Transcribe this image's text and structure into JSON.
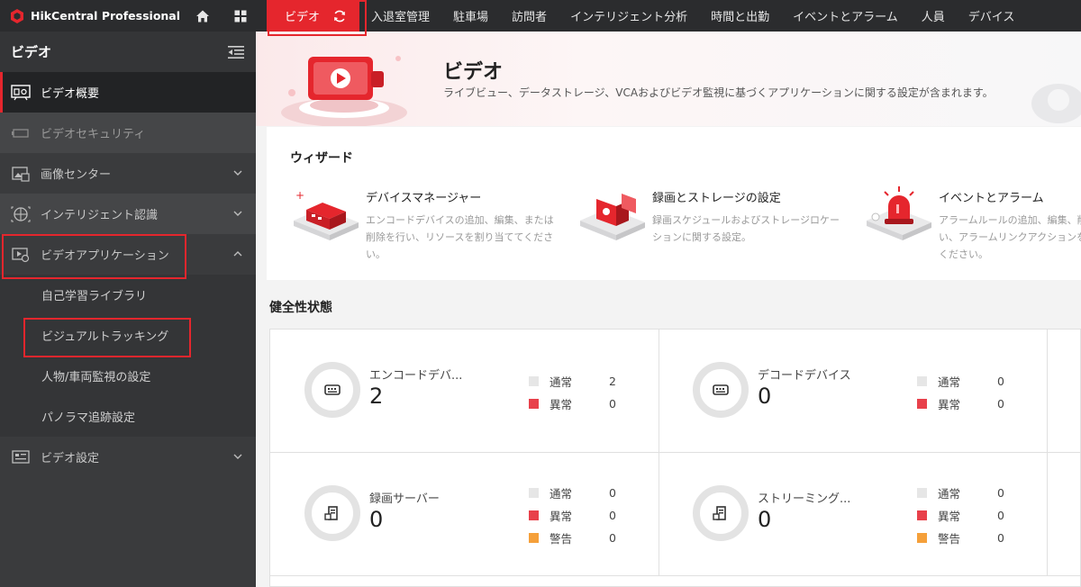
{
  "app": {
    "name": "HikCentral Professional"
  },
  "topnav": {
    "items": [
      {
        "label": "ビデオ",
        "active": true
      },
      {
        "label": "入退室管理"
      },
      {
        "label": "駐車場"
      },
      {
        "label": "訪問者"
      },
      {
        "label": "インテリジェント分析"
      },
      {
        "label": "時間と出勤"
      },
      {
        "label": "イベントとアラーム"
      },
      {
        "label": "人員"
      },
      {
        "label": "デバイス"
      }
    ]
  },
  "sidebar": {
    "title": "ビデオ",
    "items": [
      {
        "label": "ビデオ概要",
        "icon": "video-overview-icon",
        "active": true
      },
      {
        "label": "ビデオセキュリティ",
        "icon": "camera-icon"
      },
      {
        "label": "画像センター",
        "icon": "image-icon",
        "expandable": true
      },
      {
        "label": "インテリジェント認識",
        "icon": "recognition-icon",
        "expandable": true
      },
      {
        "label": "ビデオアプリケーション",
        "icon": "video-app-icon",
        "expanded": true
      },
      {
        "label": "ビデオ設定",
        "icon": "video-settings-icon",
        "expandable": true
      }
    ],
    "subitems": [
      {
        "label": "自己学習ライブラリ"
      },
      {
        "label": "ビジュアルトラッキング"
      },
      {
        "label": "人物/車両監視の設定"
      },
      {
        "label": "パノラマ追跡設定"
      }
    ]
  },
  "banner": {
    "title": "ビデオ",
    "subtitle": "ライブビュー、データストレージ、VCAおよびビデオ監視に基づくアプリケーションに関する設定が含まれます。"
  },
  "wizard": {
    "title": "ウィザード",
    "cards": [
      {
        "name": "デバイスマネージャー",
        "desc": "エンコードデバイスの追加、編集、または削除を行い、リソースを割り当ててください。"
      },
      {
        "name": "録画とストレージの設定",
        "desc": "録画スケジュールおよびストレージロケーションに関する設定。"
      },
      {
        "name": "イベントとアラーム",
        "desc": "アラームルールの追加、編集、削除を行い、アラームリンクアクションを設定してください。"
      }
    ]
  },
  "health": {
    "title": "健全性状態",
    "colors": {
      "normal": "#e6e6e6",
      "error": "#e8414b",
      "warning": "#f5a03a"
    },
    "cells": [
      {
        "name": "エンコードデバ...",
        "count": "2",
        "icon": "encoder-icon",
        "legend": [
          {
            "label": "通常",
            "value": "2",
            "kind": "normal"
          },
          {
            "label": "異常",
            "value": "0",
            "kind": "error"
          }
        ]
      },
      {
        "name": "デコードデバイス",
        "count": "0",
        "icon": "decoder-icon",
        "legend": [
          {
            "label": "通常",
            "value": "0",
            "kind": "normal"
          },
          {
            "label": "異常",
            "value": "0",
            "kind": "error"
          }
        ]
      },
      {
        "name": "録画サーバー",
        "count": "0",
        "icon": "recording-server-icon",
        "legend": [
          {
            "label": "通常",
            "value": "0",
            "kind": "normal"
          },
          {
            "label": "異常",
            "value": "0",
            "kind": "error"
          },
          {
            "label": "警告",
            "value": "0",
            "kind": "warning"
          }
        ]
      },
      {
        "name": "ストリーミング...",
        "count": "0",
        "icon": "streaming-server-icon",
        "legend": [
          {
            "label": "通常",
            "value": "0",
            "kind": "normal"
          },
          {
            "label": "異常",
            "value": "0",
            "kind": "error"
          },
          {
            "label": "警告",
            "value": "0",
            "kind": "warning"
          }
        ]
      }
    ]
  }
}
